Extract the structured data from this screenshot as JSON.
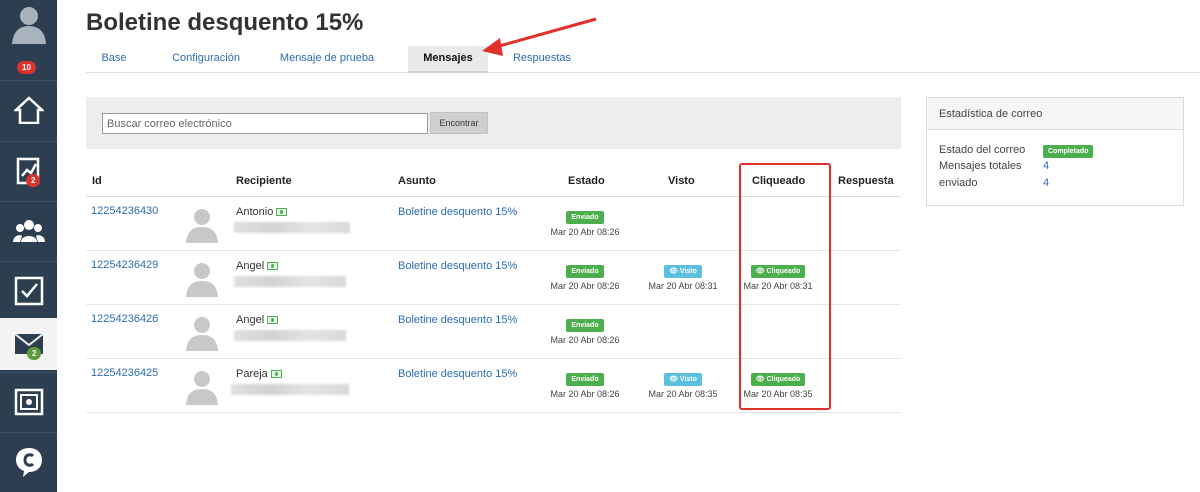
{
  "sidebar": {
    "profile_badge": "10",
    "chart_badge": "2",
    "mail_badge": "2"
  },
  "page": {
    "title": "Boletine desquento 15%"
  },
  "tabs": [
    {
      "label": "Base"
    },
    {
      "label": "Configuración"
    },
    {
      "label": "Mensaje de prueba"
    },
    {
      "label": "Mensajes"
    },
    {
      "label": "Respuestas"
    }
  ],
  "search": {
    "placeholder": "Buscar correo electrónico",
    "button": "Encontrar"
  },
  "table": {
    "headers": [
      "Id",
      "Recipiente",
      "Asunto",
      "Estado",
      "Visto",
      "Cliqueado",
      "Respuesta"
    ],
    "rows": [
      {
        "id": "12254236430",
        "name": "Antonio",
        "subject": "Boletine desquento 15%",
        "estado": "Enviado",
        "estado_ts": "Mar 20 Abr 08:26",
        "visto": "",
        "visto_ts": "",
        "cliqueado": "",
        "cliqueado_ts": ""
      },
      {
        "id": "12254236429",
        "name": "Angel",
        "subject": "Boletine desquento 15%",
        "estado": "Enviado",
        "estado_ts": "Mar 20 Abr 08:26",
        "visto": "Visto",
        "visto_ts": "Mar 20 Abr 08:31",
        "cliqueado": "Cliqueado",
        "cliqueado_ts": "Mar 20 Abr 08:31"
      },
      {
        "id": "12254236426",
        "name": "Angel",
        "subject": "Boletine desquento 15%",
        "estado": "Enviado",
        "estado_ts": "Mar 20 Abr 08:26",
        "visto": "",
        "visto_ts": "",
        "cliqueado": "",
        "cliqueado_ts": ""
      },
      {
        "id": "12254236425",
        "name": "Pareja",
        "subject": "Boletine desquento 15%",
        "estado": "Enviado",
        "estado_ts": "Mar 20 Abr 08:26",
        "visto": "Visto",
        "visto_ts": "Mar 20 Abr 08:35",
        "cliqueado": "Cliqueado",
        "cliqueado_ts": "Mar 20 Abr 08:35"
      }
    ]
  },
  "stats": {
    "title": "Estadística de correo",
    "estado_label": "Estado del correo",
    "estado_value": "Completado",
    "totales_label": "Mensajes totales",
    "totales_value": "4",
    "enviado_label": "enviado",
    "enviado_value": "4"
  },
  "colors": {
    "sidebar": "#2c3e50",
    "link": "#2a6db0",
    "status_green": "#4cae4c",
    "status_blue": "#5bc0de",
    "highlight_red": "#e0312b"
  }
}
